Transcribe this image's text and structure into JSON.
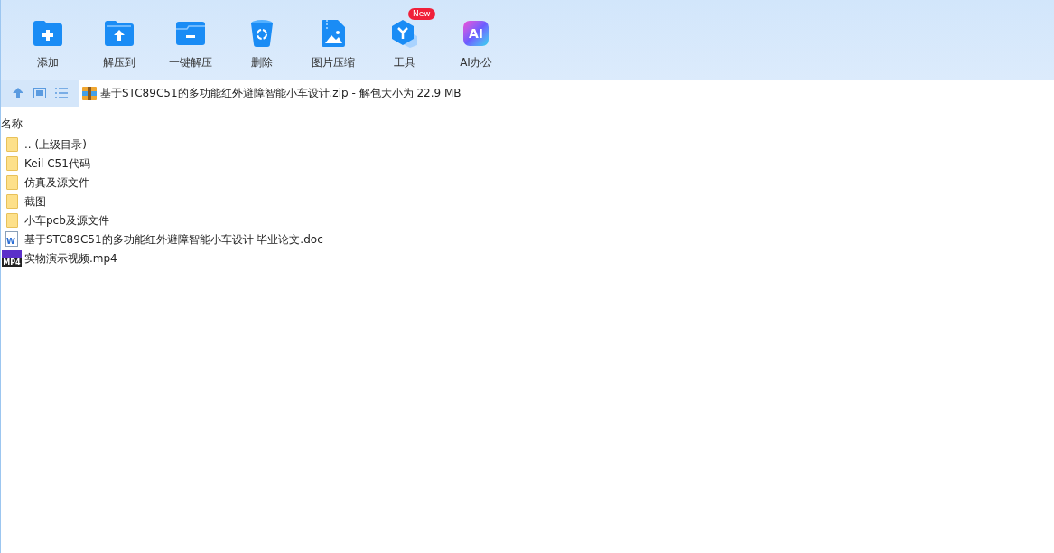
{
  "toolbar": [
    {
      "label": "添加",
      "kind": "add"
    },
    {
      "label": "解压到",
      "kind": "extract-to"
    },
    {
      "label": "一键解压",
      "kind": "one-click"
    },
    {
      "label": "删除",
      "kind": "delete"
    },
    {
      "label": "图片压缩",
      "kind": "image"
    },
    {
      "label": "工具",
      "kind": "tools",
      "badge": "New"
    },
    {
      "label": "AI办公",
      "kind": "ai",
      "icon_text": "AI"
    }
  ],
  "address": {
    "path": "基于STC89C51的多功能红外避障智能小车设计.zip - 解包大小为 22.9 MB"
  },
  "table": {
    "columns": [
      "名称"
    ],
    "rows": [
      {
        "name": ".. (上级目录)",
        "kind": "folder"
      },
      {
        "name": "Keil C51代码",
        "kind": "folder"
      },
      {
        "name": "仿真及源文件",
        "kind": "folder"
      },
      {
        "name": "截图",
        "kind": "folder"
      },
      {
        "name": "小车pcb及源文件",
        "kind": "folder"
      },
      {
        "name": "基于STC89C51的多功能红外避障智能小车设计 毕业论文.doc",
        "kind": "doc",
        "icon_text": "W"
      },
      {
        "name": "实物演示视频.mp4",
        "kind": "video",
        "icon_text": "MP4"
      }
    ]
  }
}
